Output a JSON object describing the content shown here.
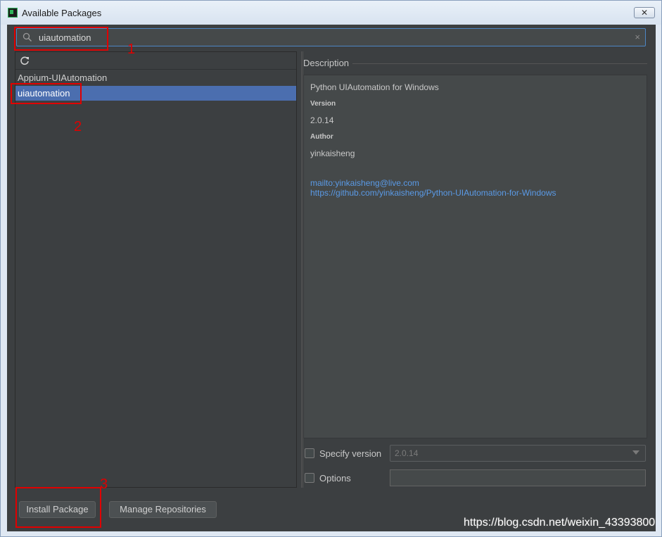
{
  "window": {
    "title": "Available Packages",
    "close_glyph": "✕"
  },
  "search": {
    "value": "uiautomation",
    "clear_glyph": "×"
  },
  "package_list": {
    "items": [
      {
        "label": "Appium-UIAutomation",
        "selected": false
      },
      {
        "label": "uiautomation",
        "selected": true
      }
    ]
  },
  "description": {
    "section_label": "Description",
    "summary": "Python UIAutomation for Windows",
    "version_heading": "Version",
    "version_value": "2.0.14",
    "author_heading": "Author",
    "author_value": "yinkaisheng",
    "links": [
      "mailto:yinkaisheng@live.com",
      "https://github.com/yinkaisheng/Python-UIAutomation-for-Windows"
    ]
  },
  "options": {
    "specify_version_label": "Specify version",
    "specify_version_checked": false,
    "version_select_value": "2.0.14",
    "options_label": "Options",
    "options_checked": false,
    "options_value": ""
  },
  "buttons": {
    "install": "Install Package",
    "manage": "Manage Repositories"
  },
  "annotations": [
    "1",
    "2",
    "3"
  ],
  "watermark": "https://blog.csdn.net/weixin_43393800",
  "colors": {
    "panel_bg": "#3c3f41",
    "selection": "#4b6eaf",
    "link": "#5a9ae6",
    "annotation_red": "#e00000"
  },
  "icons": [
    "app-icon",
    "search-icon",
    "clear-icon",
    "refresh-icon",
    "close-icon",
    "chevron-down-icon"
  ]
}
